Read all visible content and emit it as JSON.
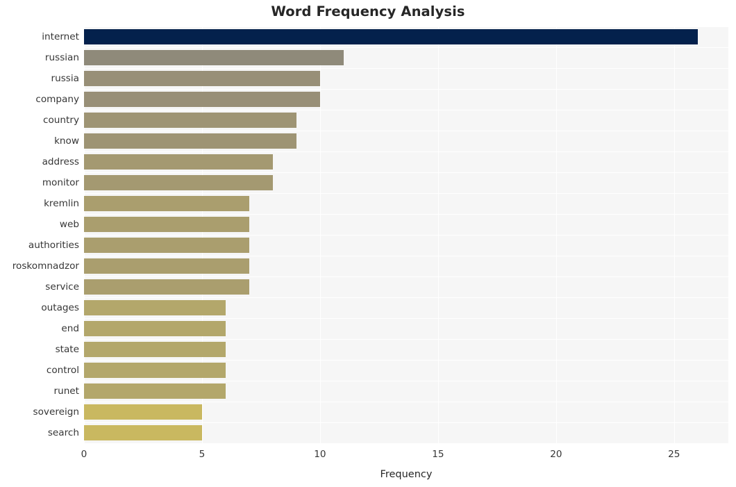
{
  "chart_data": {
    "type": "bar",
    "orientation": "horizontal",
    "title": "Word Frequency Analysis",
    "xlabel": "Frequency",
    "ylabel": "",
    "categories": [
      "internet",
      "russian",
      "russia",
      "company",
      "country",
      "know",
      "address",
      "monitor",
      "kremlin",
      "web",
      "authorities",
      "roskomnadzor",
      "service",
      "outages",
      "end",
      "state",
      "control",
      "runet",
      "sovereign",
      "search"
    ],
    "values": [
      26,
      11,
      10,
      10,
      9,
      9,
      8,
      8,
      7,
      7,
      7,
      7,
      7,
      6,
      6,
      6,
      6,
      6,
      5,
      5
    ],
    "bar_colors": [
      "#04214c",
      "#8f8a7a",
      "#988f77",
      "#988f77",
      "#9e9474",
      "#9e9474",
      "#a49971",
      "#a49971",
      "#aa9e6e",
      "#aa9e6e",
      "#aa9e6e",
      "#aa9e6e",
      "#aa9e6e",
      "#b3a76b",
      "#b3a76b",
      "#b3a76b",
      "#b3a76b",
      "#b3a76b",
      "#c9b860",
      "#c9b860"
    ],
    "xlim": [
      0,
      27.3
    ],
    "xticks": [
      0,
      5,
      10,
      15,
      20,
      25
    ],
    "xtick_labels": [
      "0",
      "5",
      "10",
      "15",
      "20",
      "25"
    ],
    "grid": true,
    "grid_color": "#ffffff",
    "plot_background": "#f6f6f6",
    "figure_background": "#ffffff",
    "legend": null
  }
}
